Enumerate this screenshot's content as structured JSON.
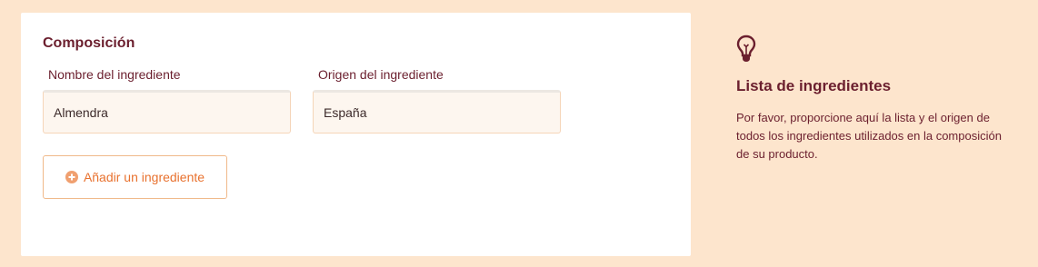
{
  "form": {
    "section_title": "Composición",
    "ingredient_name_label": "Nombre del ingrediente",
    "ingredient_origin_label": "Origen del ingrediente",
    "ingredients": [
      {
        "name": "Almendra",
        "origin": "España"
      }
    ],
    "add_button_label": "Añadir un ingrediente",
    "add_button_icon": "plus-circle-icon"
  },
  "help": {
    "icon": "lightbulb-icon",
    "title": "Lista de ingredientes",
    "text": "Por favor, proporcione aquí la lista y el origen de todos los ingredientes utilizados en la composición de su producto."
  },
  "colors": {
    "background": "#fde5cd",
    "primary_text": "#6b1f2e",
    "accent": "#e8712e"
  }
}
